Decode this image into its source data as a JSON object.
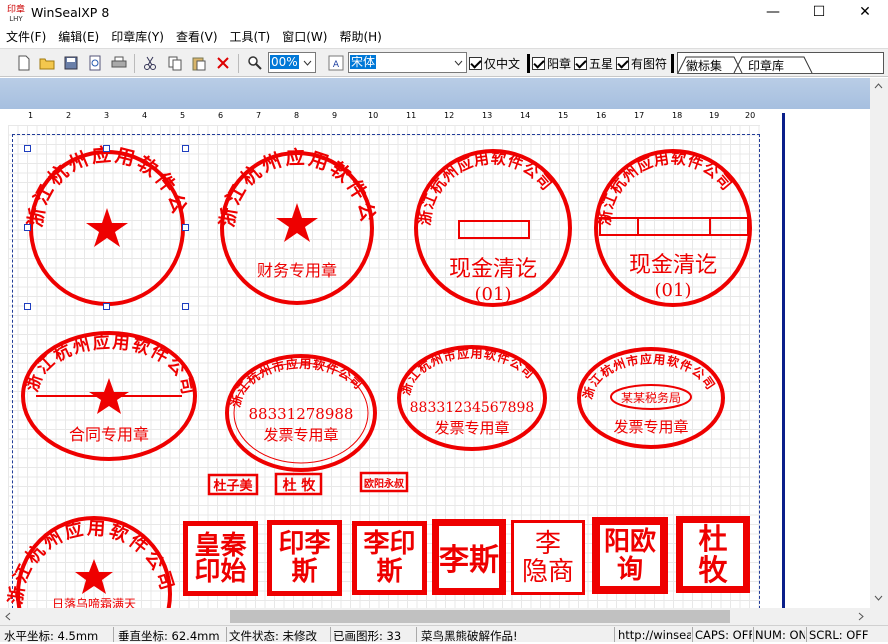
{
  "window": {
    "title": "WinSealXP 8",
    "app_icon_text_top": "印章",
    "app_icon_text_bottom": "LHY",
    "minimize": "—",
    "maximize": "☐",
    "close": "✕"
  },
  "menu": [
    "文件(F)",
    "编辑(E)",
    "印章库(Y)",
    "查看(V)",
    "工具(T)",
    "窗口(W)",
    "帮助(H)"
  ],
  "toolbar": {
    "zoom_value": "00%",
    "font_value": "宋体",
    "options": [
      {
        "label": "仅中文",
        "checked": true
      },
      {
        "label": "阳章",
        "checked": true
      },
      {
        "label": "五星",
        "checked": true
      },
      {
        "label": "有图符",
        "checked": true
      }
    ],
    "tabs": [
      "徽标集",
      "印章库"
    ]
  },
  "ruler": [
    "1",
    "2",
    "3",
    "4",
    "5",
    "6",
    "7",
    "8",
    "9",
    "10",
    "11",
    "12",
    "13",
    "14",
    "15",
    "16",
    "17",
    "18",
    "19",
    "20"
  ],
  "seals": {
    "company": "浙江杭州应用软件公司",
    "company_short": "浙江杭州市应用软件公司",
    "finance": "财务专用章",
    "cash": "现金清讫",
    "cash_code": "(01)",
    "contract": "合同专用章",
    "invoice_no1": "88331278988",
    "invoice_no2": "88331234567898",
    "invoice": "发票专用章",
    "tax": "某某税务局",
    "bottom_text": "日落乌啼霜满天",
    "small": [
      "杜子美",
      "杜 牧",
      "欧阳永叔"
    ],
    "square": [
      "皇秦\n印始",
      "印李\n斯",
      "李印\n斯",
      "李斯",
      "李\n隐商",
      "阳欧\n询",
      "杜\n牧"
    ]
  },
  "status": {
    "x": "水平坐标: 4.5mm",
    "y": "垂直坐标: 62.4mm",
    "file": "文件状态: 未修改",
    "shapes": "已画图形: 33",
    "credit": "菜鸟黑熊破解作品!",
    "url": "http://winsealxp",
    "caps": "CAPS: OFF",
    "num": "NUM: ON",
    "scrl": "SCRL: OFF"
  }
}
